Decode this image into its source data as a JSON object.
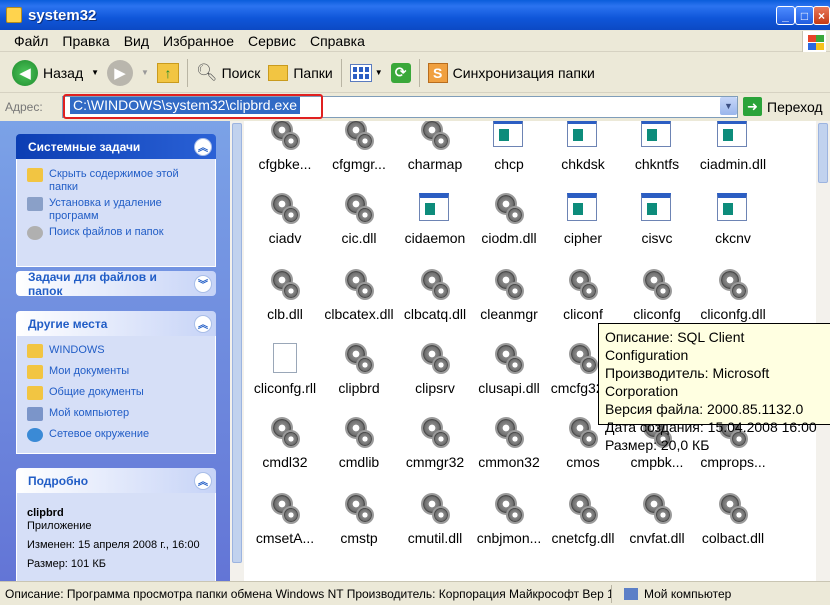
{
  "window": {
    "title": "system32"
  },
  "menu": [
    "Файл",
    "Правка",
    "Вид",
    "Избранное",
    "Сервис",
    "Справка"
  ],
  "toolbar": {
    "back": "Назад",
    "search": "Поиск",
    "folders": "Папки",
    "sync": "Синхронизация папки"
  },
  "address": {
    "label": "Адрес:",
    "value": "C:\\WINDOWS\\system32\\clipbrd.exe",
    "go": "Переход"
  },
  "left": {
    "system_tasks": {
      "title": "Системные задачи",
      "items": [
        "Скрыть содержимое этой папки",
        "Установка и удаление программ",
        "Поиск файлов и папок"
      ]
    },
    "file_tasks": {
      "title": "Задачи для файлов и папок"
    },
    "other_places": {
      "title": "Другие места",
      "items": [
        "WINDOWS",
        "Мои документы",
        "Общие документы",
        "Мой компьютер",
        "Сетевое окружение"
      ]
    },
    "details": {
      "title": "Подробно",
      "name": "clipbrd",
      "type": "Приложение",
      "modified": "Изменен: 15 апреля 2008 г., 16:00",
      "size": "Размер: 101 КБ"
    }
  },
  "files": [
    [
      "cfgbke...",
      "cfgmgr...",
      "charmap",
      "chcp",
      "chkdsk",
      "chkntfs",
      "ciadmin.dll"
    ],
    [
      "ciadv",
      "cic.dll",
      "cidaemon",
      "ciodm.dll",
      "cipher",
      "cisvc",
      "ckcnv"
    ],
    [
      "clb.dll",
      "clbcatex.dll",
      "clbcatq.dll",
      "cleanmgr",
      "cliconf",
      "cliconfg",
      "cliconfg.dll"
    ],
    [
      "cliconfg.rll",
      "clipbrd",
      "clipsrv",
      "clusapi.dll",
      "cmcfg32...",
      "",
      ""
    ],
    [
      "cmdl32",
      "cmdlib",
      "cmmgr32",
      "cmmon32",
      "cmos",
      "cmpbk...",
      "cmprops..."
    ],
    [
      "cmsetA...",
      "cmstp",
      "cmutil.dll",
      "cnbjmon...",
      "cnetcfg.dll",
      "cnvfat.dll",
      "colbact.dll"
    ]
  ],
  "tooltip": {
    "desc": "Описание: SQL Client Configuration",
    "maker": "Производитель: Microsoft Corporation",
    "version": "Версия файла: 2000.85.1132.0",
    "date": "Дата создания: 15.04.2008 16:00",
    "size": "Размер: 20,0 КБ"
  },
  "status": {
    "text": "Описание: Программа просмотра папки обмена Windows NT Производитель: Корпорация Майкрософт Вер  101 КБ",
    "location": "Мой компьютер"
  },
  "colors": {
    "title": "#0a5ddb",
    "selection": "#316ac5",
    "tooltip": "#ffffe1",
    "highlight": "#e02020"
  }
}
